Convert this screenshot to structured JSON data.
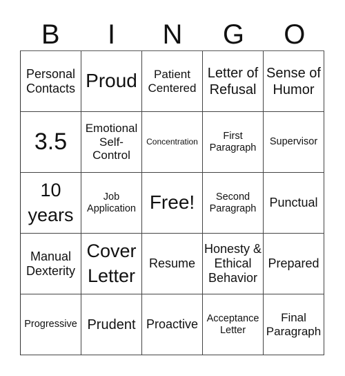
{
  "header": {
    "letters": [
      "B",
      "I",
      "N",
      "G",
      "O"
    ]
  },
  "cells": [
    [
      "Personal Contacts",
      "Proud",
      "Patient Centered",
      "Letter of Refusal",
      "Sense of Humor"
    ],
    [
      "3.5",
      "Emotional Self-Control",
      "Concentration",
      "First Paragraph",
      "Supervisor"
    ],
    [
      "10 years",
      "Job Application",
      "Free!",
      "Second Paragraph",
      "Punctual"
    ],
    [
      "Manual Dexterity",
      "Cover Letter",
      "Resume",
      "Honesty & Ethical Behavior",
      "Prepared"
    ],
    [
      "Progressive",
      "Prudent",
      "Proactive",
      "Acceptance Letter",
      "Final Paragraph"
    ]
  ]
}
